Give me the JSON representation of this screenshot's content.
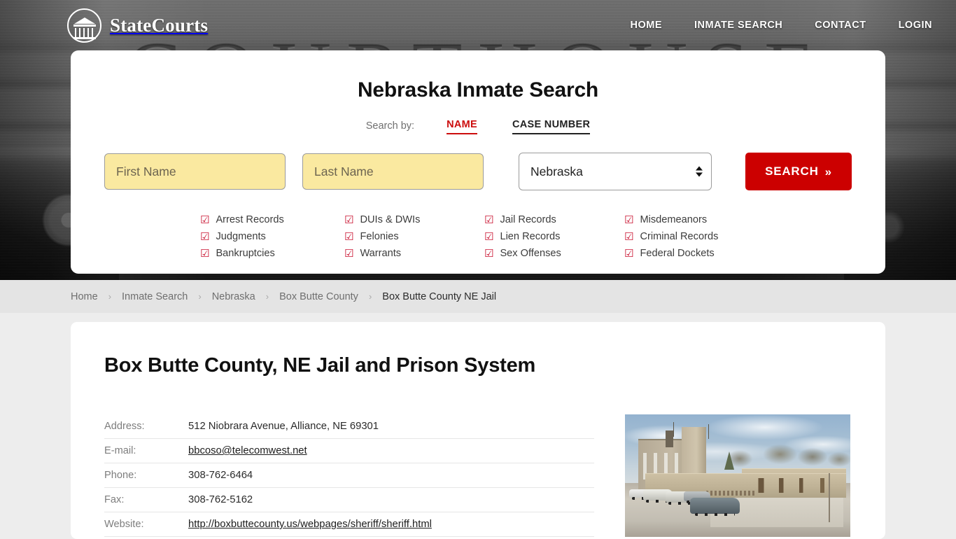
{
  "brand": {
    "name": "StateCourts",
    "icon": "courthouse-logo-icon"
  },
  "nav": {
    "items": [
      {
        "label": "HOME"
      },
      {
        "label": "INMATE SEARCH"
      },
      {
        "label": "CONTACT"
      },
      {
        "label": "LOGIN"
      }
    ]
  },
  "hero": {
    "background_text": "COURTHOUSE"
  },
  "search": {
    "title": "Nebraska Inmate Search",
    "search_by_label": "Search by:",
    "tabs": [
      {
        "label": "NAME",
        "active": true
      },
      {
        "label": "CASE NUMBER",
        "active": false
      }
    ],
    "first_name": {
      "placeholder": "First Name",
      "value": ""
    },
    "last_name": {
      "placeholder": "Last Name",
      "value": ""
    },
    "state_select": {
      "value": "Nebraska",
      "options": [
        "Nebraska"
      ]
    },
    "submit_label": "SEARCH",
    "submit_chevron": "»",
    "accent_red": "#cc0000",
    "field_yellow": "#fae9a0",
    "checkbox_glyph": "☑",
    "checkboxes": [
      "Arrest Records",
      "DUIs & DWIs",
      "Jail Records",
      "Misdemeanors",
      "Judgments",
      "Felonies",
      "Lien Records",
      "Criminal Records",
      "Bankruptcies",
      "Warrants",
      "Sex Offenses",
      "Federal Dockets"
    ]
  },
  "breadcrumb": {
    "separator": "›",
    "items": [
      {
        "label": "Home",
        "current": false
      },
      {
        "label": "Inmate Search",
        "current": false
      },
      {
        "label": "Nebraska",
        "current": false
      },
      {
        "label": "Box Butte County",
        "current": false
      },
      {
        "label": "Box Butte County NE Jail",
        "current": true
      }
    ]
  },
  "page": {
    "title": "Box Butte County, NE Jail and Prison System",
    "details": [
      {
        "label": "Address:",
        "value": "512 Niobrara Avenue, Alliance, NE 69301",
        "link": false
      },
      {
        "label": "E-mail:",
        "value": "bbcoso@telecomwest.net",
        "link": true
      },
      {
        "label": "Phone:",
        "value": "308-762-6464",
        "link": false
      },
      {
        "label": "Fax:",
        "value": "308-762-5162",
        "link": false
      },
      {
        "label": "Website:",
        "value": "http://boxbuttecounty.us/webpages/sheriff/sheriff.html",
        "link": true
      }
    ],
    "photo_alt": "Box Butte County Law Enforcement Center building with parking lot"
  }
}
